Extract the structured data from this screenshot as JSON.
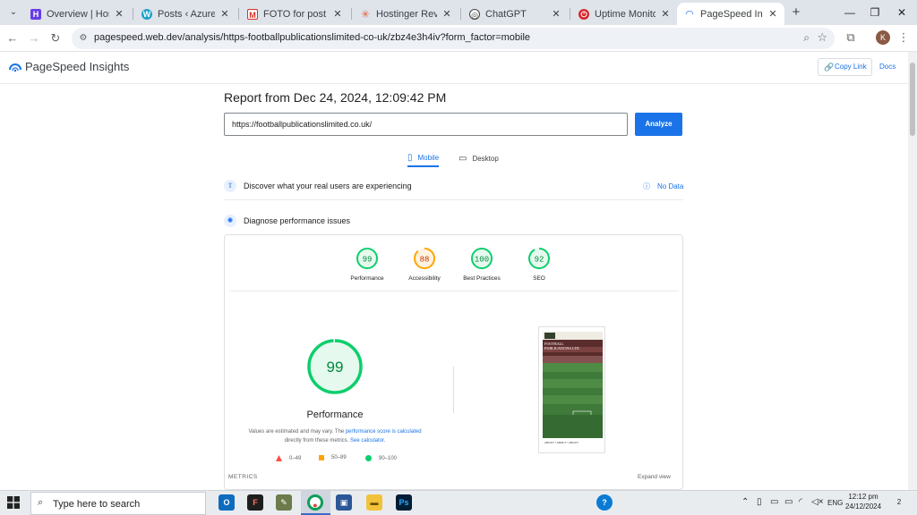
{
  "browser": {
    "tabs": [
      {
        "title": "Overview | Hostinger",
        "favicon": "hostinger-icon",
        "color": "#673de6",
        "active": false
      },
      {
        "title": "Posts ‹ AzureSky Web",
        "favicon": "wordpress-icon",
        "color": "#21a0c8",
        "active": false
      },
      {
        "title": "FOTO for post - kosta",
        "favicon": "gmail-icon",
        "color": "#d93025",
        "active": false
      },
      {
        "title": "Hostinger Review: Co",
        "favicon": "star-burst-icon",
        "color": "#e8663d",
        "active": false
      },
      {
        "title": "ChatGPT",
        "favicon": "chatgpt-icon",
        "color": "#444444",
        "active": false
      },
      {
        "title": "Uptime Monitor Pric",
        "favicon": "power-icon",
        "color": "#d8262c",
        "active": false
      },
      {
        "title": "PageSpeed Insights",
        "favicon": "pagespeed-icon",
        "color": "#1a73e8",
        "active": true
      }
    ],
    "url": "pagespeed.web.dev/analysis/https-footballpublicationslimited-co-uk/zbz4e3h4iv?form_factor=mobile",
    "profile_initial": "K"
  },
  "psi": {
    "brand": "PageSpeed Insights",
    "copy_link": "Copy Link",
    "docs": "Docs",
    "report_title": "Report from Dec 24, 2024, 12:09:42 PM",
    "url_value": "https://footballpublicationslimited.co.uk/",
    "analyze": "Analyze",
    "device_tabs": [
      {
        "label": "Mobile",
        "active": true
      },
      {
        "label": "Desktop",
        "active": false
      }
    ],
    "discover_text": "Discover what your real users are experiencing",
    "no_data": "No Data",
    "diagnose_text": "Diagnose performance issues",
    "categories": [
      {
        "label": "Performance",
        "score": 99,
        "color": "#0cce6b"
      },
      {
        "label": "Accessibility",
        "score": 88,
        "color": "#ffa400"
      },
      {
        "label": "Best Practices",
        "score": 100,
        "color": "#0cce6b"
      },
      {
        "label": "SEO",
        "score": 92,
        "color": "#0cce6b"
      }
    ],
    "big_score": 99,
    "perf_title": "Performance",
    "note_prefix": "Values are estimated and may vary. The ",
    "note_link1": "performance score is calculated",
    "note_middle": " directly from these metrics. ",
    "note_link2": "See calculator.",
    "legend": [
      {
        "range": "0–49",
        "color": "#ff4e42",
        "shape": "triangle"
      },
      {
        "range": "50–89",
        "color": "#ffa400",
        "shape": "square"
      },
      {
        "range": "90–100",
        "color": "#0cce6b",
        "shape": "circle"
      }
    ],
    "metrics_label": "METRICS",
    "expand_view": "Expand view",
    "screenshot_caption_1": "FOOTBALL",
    "screenshot_caption_2": "PUBLICATIONS LTD.",
    "screenshot_footer": "ABOUT • ABOUT • ABOUT"
  },
  "taskbar": {
    "search_placeholder": "Type here to search",
    "time": "12:12 pm",
    "date": "24/12/2024",
    "language": "ENG",
    "notifications": "2"
  }
}
